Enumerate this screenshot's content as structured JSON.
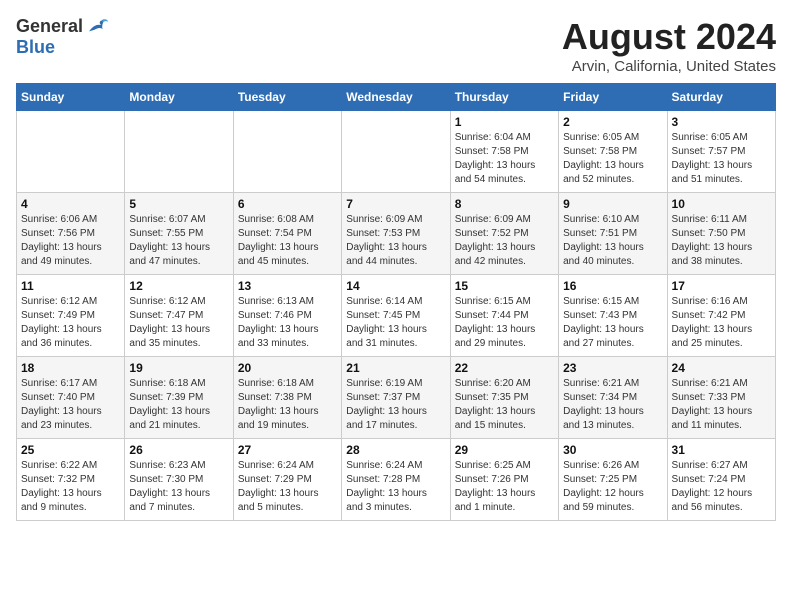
{
  "header": {
    "logo_general": "General",
    "logo_blue": "Blue",
    "month_title": "August 2024",
    "location": "Arvin, California, United States"
  },
  "weekdays": [
    "Sunday",
    "Monday",
    "Tuesday",
    "Wednesday",
    "Thursday",
    "Friday",
    "Saturday"
  ],
  "weeks": [
    [
      {
        "day": "",
        "info": ""
      },
      {
        "day": "",
        "info": ""
      },
      {
        "day": "",
        "info": ""
      },
      {
        "day": "",
        "info": ""
      },
      {
        "day": "1",
        "info": "Sunrise: 6:04 AM\nSunset: 7:58 PM\nDaylight: 13 hours\nand 54 minutes."
      },
      {
        "day": "2",
        "info": "Sunrise: 6:05 AM\nSunset: 7:58 PM\nDaylight: 13 hours\nand 52 minutes."
      },
      {
        "day": "3",
        "info": "Sunrise: 6:05 AM\nSunset: 7:57 PM\nDaylight: 13 hours\nand 51 minutes."
      }
    ],
    [
      {
        "day": "4",
        "info": "Sunrise: 6:06 AM\nSunset: 7:56 PM\nDaylight: 13 hours\nand 49 minutes."
      },
      {
        "day": "5",
        "info": "Sunrise: 6:07 AM\nSunset: 7:55 PM\nDaylight: 13 hours\nand 47 minutes."
      },
      {
        "day": "6",
        "info": "Sunrise: 6:08 AM\nSunset: 7:54 PM\nDaylight: 13 hours\nand 45 minutes."
      },
      {
        "day": "7",
        "info": "Sunrise: 6:09 AM\nSunset: 7:53 PM\nDaylight: 13 hours\nand 44 minutes."
      },
      {
        "day": "8",
        "info": "Sunrise: 6:09 AM\nSunset: 7:52 PM\nDaylight: 13 hours\nand 42 minutes."
      },
      {
        "day": "9",
        "info": "Sunrise: 6:10 AM\nSunset: 7:51 PM\nDaylight: 13 hours\nand 40 minutes."
      },
      {
        "day": "10",
        "info": "Sunrise: 6:11 AM\nSunset: 7:50 PM\nDaylight: 13 hours\nand 38 minutes."
      }
    ],
    [
      {
        "day": "11",
        "info": "Sunrise: 6:12 AM\nSunset: 7:49 PM\nDaylight: 13 hours\nand 36 minutes."
      },
      {
        "day": "12",
        "info": "Sunrise: 6:12 AM\nSunset: 7:47 PM\nDaylight: 13 hours\nand 35 minutes."
      },
      {
        "day": "13",
        "info": "Sunrise: 6:13 AM\nSunset: 7:46 PM\nDaylight: 13 hours\nand 33 minutes."
      },
      {
        "day": "14",
        "info": "Sunrise: 6:14 AM\nSunset: 7:45 PM\nDaylight: 13 hours\nand 31 minutes."
      },
      {
        "day": "15",
        "info": "Sunrise: 6:15 AM\nSunset: 7:44 PM\nDaylight: 13 hours\nand 29 minutes."
      },
      {
        "day": "16",
        "info": "Sunrise: 6:15 AM\nSunset: 7:43 PM\nDaylight: 13 hours\nand 27 minutes."
      },
      {
        "day": "17",
        "info": "Sunrise: 6:16 AM\nSunset: 7:42 PM\nDaylight: 13 hours\nand 25 minutes."
      }
    ],
    [
      {
        "day": "18",
        "info": "Sunrise: 6:17 AM\nSunset: 7:40 PM\nDaylight: 13 hours\nand 23 minutes."
      },
      {
        "day": "19",
        "info": "Sunrise: 6:18 AM\nSunset: 7:39 PM\nDaylight: 13 hours\nand 21 minutes."
      },
      {
        "day": "20",
        "info": "Sunrise: 6:18 AM\nSunset: 7:38 PM\nDaylight: 13 hours\nand 19 minutes."
      },
      {
        "day": "21",
        "info": "Sunrise: 6:19 AM\nSunset: 7:37 PM\nDaylight: 13 hours\nand 17 minutes."
      },
      {
        "day": "22",
        "info": "Sunrise: 6:20 AM\nSunset: 7:35 PM\nDaylight: 13 hours\nand 15 minutes."
      },
      {
        "day": "23",
        "info": "Sunrise: 6:21 AM\nSunset: 7:34 PM\nDaylight: 13 hours\nand 13 minutes."
      },
      {
        "day": "24",
        "info": "Sunrise: 6:21 AM\nSunset: 7:33 PM\nDaylight: 13 hours\nand 11 minutes."
      }
    ],
    [
      {
        "day": "25",
        "info": "Sunrise: 6:22 AM\nSunset: 7:32 PM\nDaylight: 13 hours\nand 9 minutes."
      },
      {
        "day": "26",
        "info": "Sunrise: 6:23 AM\nSunset: 7:30 PM\nDaylight: 13 hours\nand 7 minutes."
      },
      {
        "day": "27",
        "info": "Sunrise: 6:24 AM\nSunset: 7:29 PM\nDaylight: 13 hours\nand 5 minutes."
      },
      {
        "day": "28",
        "info": "Sunrise: 6:24 AM\nSunset: 7:28 PM\nDaylight: 13 hours\nand 3 minutes."
      },
      {
        "day": "29",
        "info": "Sunrise: 6:25 AM\nSunset: 7:26 PM\nDaylight: 13 hours\nand 1 minute."
      },
      {
        "day": "30",
        "info": "Sunrise: 6:26 AM\nSunset: 7:25 PM\nDaylight: 12 hours\nand 59 minutes."
      },
      {
        "day": "31",
        "info": "Sunrise: 6:27 AM\nSunset: 7:24 PM\nDaylight: 12 hours\nand 56 minutes."
      }
    ]
  ]
}
